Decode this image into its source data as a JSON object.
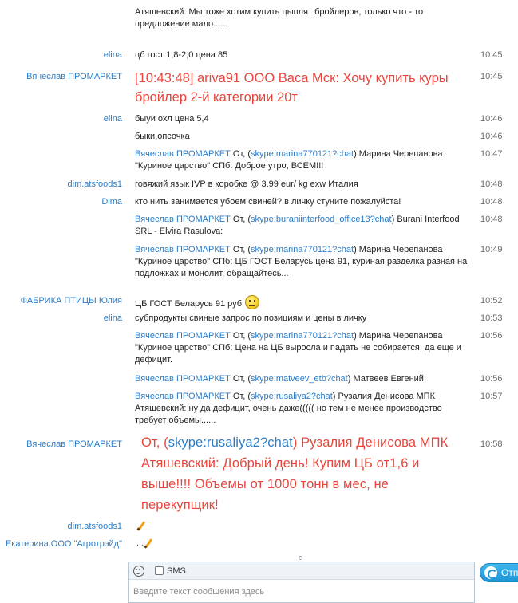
{
  "messages": [
    {
      "sender": "",
      "time": "",
      "text": "Атяшевский: Мы тоже хотим купить цыплят бройлеров, только что - то предложение мало......"
    },
    {
      "sender": "elina",
      "time": "10:45",
      "text": "цб гост 1,8-2,0 цена 85"
    },
    {
      "sender": "Вячеслав ПРОМАРКЕТ",
      "time": "10:45",
      "text": "[10:43:48] ariva91 ООО Васа Мск: Хочу купить куры бройлер 2-й категории 20т"
    },
    {
      "sender": "elina",
      "time": "10:46",
      "text": "быуи охл цена 5,4"
    },
    {
      "sender": "",
      "time": "10:46",
      "text": "быки,опсочка"
    },
    {
      "sender": "",
      "time": "10:47",
      "from": "Вячеслав ПРОМАРКЕТ",
      "pre": " От, (",
      "link": "skype:marina770121?chat",
      "post": ") Марина Черепанова \"Куриное царство\" СПб: Доброе утро, ВСЕМ!!!"
    },
    {
      "sender": "dim.atsfoods1",
      "time": "10:48",
      "text": "говяжий язык IVP в коробке @ 3.99 eur/ kg exw Италия"
    },
    {
      "sender": "Dima",
      "time": "10:48",
      "text": "кто нить занимается убоем свиней? в личку стуните пожалуйста!"
    },
    {
      "sender": "",
      "time": "10:48",
      "from": "Вячеслав ПРОМАРКЕТ",
      "pre": " От, (",
      "link": "skype:buraniinterfood_office13?chat",
      "post": ") Burani Interfood SRL - Elvira Rasulova:"
    },
    {
      "sender": "",
      "time": "10:49",
      "from": "Вячеслав ПРОМАРКЕТ",
      "pre": " От, (",
      "link": "skype:marina770121?chat",
      "post": ") Марина Черепанова \"Куриное царство\" СПб: ЦБ ГОСТ Беларусь цена 91, куриная  разделка разная на подложках и монолит, обращайтесь..."
    },
    {
      "sender": "ФАБРИКА ПТИЦЫ Юлия",
      "time": "10:52",
      "text": "ЦБ ГОСТ Беларусь 91 руб"
    },
    {
      "sender": "elina",
      "time": "10:53",
      "text": "субпродукты свиные  запрос по позициям  и цены в личку"
    },
    {
      "sender": "",
      "time": "10:56",
      "from": "Вячеслав ПРОМАРКЕТ",
      "pre": " От, (",
      "link": "skype:marina770121?chat",
      "post": ") Марина Черепанова \"Куриное царство\" СПб: Цена на ЦБ выросла и падать не собирается, да еще и дефицит."
    },
    {
      "sender": "",
      "time": "10:56",
      "from": "Вячеслав ПРОМАРКЕТ",
      "pre": " От, (",
      "link": "skype:matveev_etb?chat",
      "post": ") Матвеев Евгений:"
    },
    {
      "sender": "",
      "time": "10:57",
      "from": "Вячеслав ПРОМАРКЕТ",
      "pre": " От, (",
      "link": "skype:rusaliya2?chat",
      "post": ") Рузалия Денисова МПК Атяшевский: ну да дефицит, очень даже((((( но тем не менее производство требует объемы......"
    },
    {
      "sender": "Вячеслав ПРОМАРКЕТ",
      "time": "10:58",
      "pre": "От, (",
      "link": "skype:rusaliya2?chat",
      "post": ") Рузалия Денисова МПК Атяшевский: Добрый день! Купим ЦБ от1,6 и выше!!!! Объемы от 1000 тонн в мес, не перекупщик!"
    },
    {
      "sender": "dim.atsfoods1",
      "time": "",
      "text": ""
    },
    {
      "sender": "Екатерина ООО \"Агротрэйд\"",
      "time": "",
      "text": "..."
    }
  ],
  "composer": {
    "sms_label": "SMS",
    "placeholder": "Введите текст сообщения здесь"
  },
  "send_button": {
    "label": "Отправить"
  },
  "colors": {
    "sender": "#2e7cc4",
    "highlight_text": "#e8453c",
    "accent": "#1f95d6"
  }
}
